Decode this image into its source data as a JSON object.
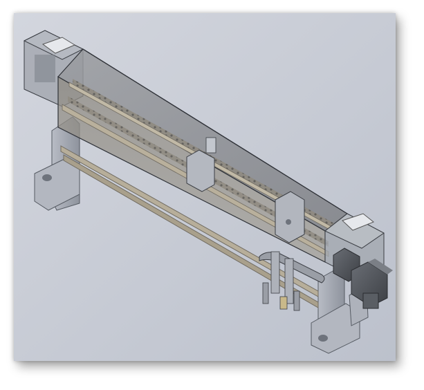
{
  "scene": {
    "subject": "machine-assembly-render",
    "colors": {
      "background": "#c8ccd6",
      "metal": "#a9aeb8",
      "metal_dark": "#7d828c",
      "glass": "#8d8f93",
      "rail": "#b9b09c",
      "motor": "#4f5257",
      "edge": "#2f3238"
    }
  }
}
